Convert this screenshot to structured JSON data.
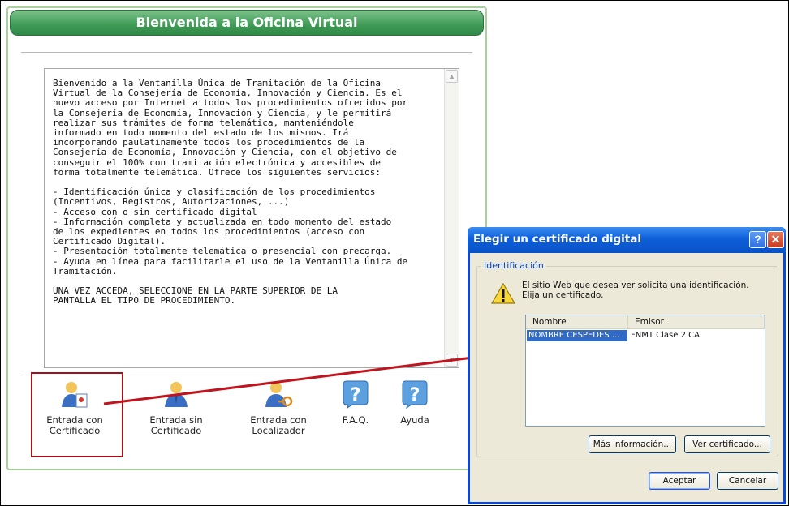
{
  "office": {
    "title": "Bienvenida a la Oficina Virtual",
    "welcome_text": "Bienvenido a la Ventanilla Única de Tramitación de la Oficina\nVirtual de la Consejería de Economía, Innovación y Ciencia. Es el\nnuevo acceso por Internet a todos los procedimientos ofrecidos por\nla Consejería de Economía, Innovación y Ciencia, y le permitirá\nrealizar sus trámites de forma telemática, manteniéndole\ninformado en todo momento del estado de los mismos. Irá\nincorporando paulatinamente todos los procedimientos de la\nConsejería de Economía, Innovación y Ciencia, con el objetivo de\nconseguir el 100% con tramitación electrónica y accesibles de\nforma totalmente telemática. Ofrece los siguientes servicios:\n\n- Identificación única y clasificación de los procedimientos\n(Incentivos, Registros, Autorizaciones, ...)\n- Acceso con o sin certificado digital\n- Información completa y actualizada en todo momento del estado\nde los expedientes en todos los procedimientos (acceso con\nCertificado Digital).\n- Presentación totalmente telemática o presencial con precarga.\n- Ayuda en línea para facilitarle el uso de la Ventanilla Única de\nTramitación.\n\nUNA VEZ ACCEDA, SELECCIONE EN LA PARTE SUPERIOR DE LA\nPANTALLA EL TIPO DE PROCEDIMIENTO.",
    "tools": [
      {
        "label": "Entrada con\nCertificado",
        "icon": "user-certificate-icon"
      },
      {
        "label": "Entrada sin\nCertificado",
        "icon": "user-icon"
      },
      {
        "label": "Entrada con\nLocalizador",
        "icon": "user-key-icon"
      },
      {
        "label": "F.A.Q.",
        "icon": "question-icon"
      },
      {
        "label": "Ayuda",
        "icon": "help-icon"
      }
    ]
  },
  "dialog": {
    "title": "Elegir un certificado digital",
    "help_glyph": "?",
    "close_glyph": "✕",
    "group_label": "Identificación",
    "prompt": "El sitio Web que desea ver solicita una identificación.\nElija un certificado.",
    "columns": [
      "Nombre",
      "Emisor"
    ],
    "rows": [
      {
        "name": "NOMBRE CESPEDES ...",
        "issuer": "FNMT Clase 2 CA"
      }
    ],
    "buttons": {
      "more_info": "Más información...",
      "view_cert": "Ver certificado...",
      "accept": "Aceptar",
      "cancel": "Cancelar"
    }
  },
  "colors": {
    "header_green": "#3f9a56",
    "highlight_red": "#a3101a",
    "dialog_blue": "#0a46d8",
    "selection_blue": "#316ac5"
  }
}
